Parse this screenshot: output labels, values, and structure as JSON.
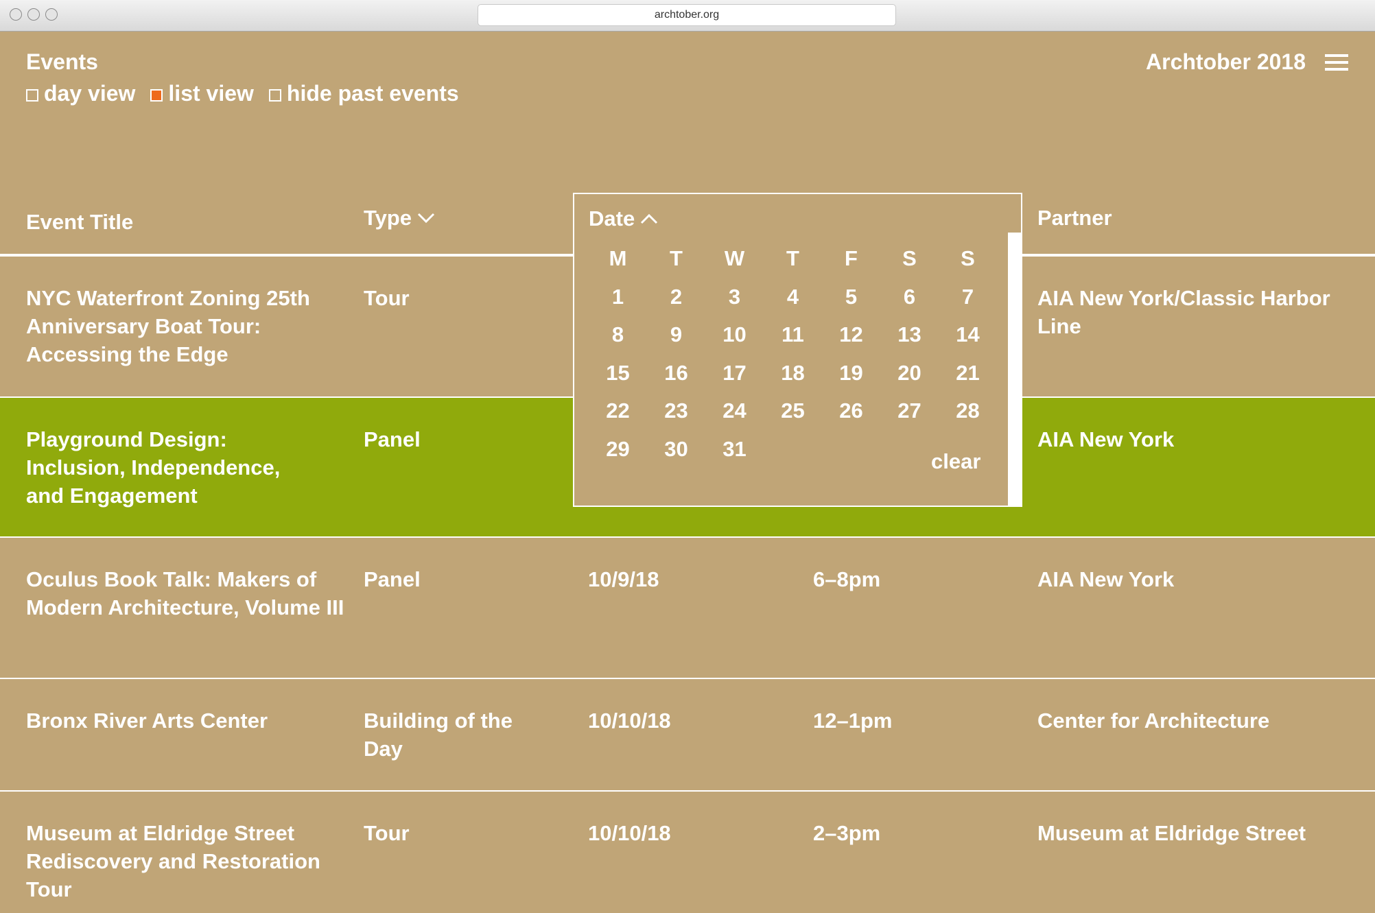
{
  "browser": {
    "url": "archtober.org"
  },
  "header": {
    "title": "Events",
    "brand": "Archtober 2018",
    "views": [
      {
        "label": "day view",
        "checked": false
      },
      {
        "label": "list view",
        "checked": true
      },
      {
        "label": "hide past events",
        "checked": false
      }
    ]
  },
  "table": {
    "columns": {
      "title": "Event Title",
      "type": "Type",
      "date": "Date",
      "partner": "Partner"
    },
    "rows": [
      {
        "title": "NYC Waterfront Zoning 25th Anniversary Boat Tour: Accessing the Edge",
        "type": "Tour",
        "date": "",
        "time": "",
        "partner": "AIA New York/Classic Harbor Line"
      },
      {
        "title": "Playground Design: Inclusion, Independence, and Engagement",
        "type": "Panel",
        "date": "",
        "time": "",
        "partner": "AIA New York",
        "highlighted": true
      },
      {
        "title": "Oculus Book Talk: Makers of Modern Architecture, Volume III",
        "type": "Panel",
        "date": "10/9/18",
        "time": "6–8pm",
        "partner": "AIA New York"
      },
      {
        "title": "Bronx River Arts Center",
        "type": "Building of the Day",
        "date": "10/10/18",
        "time": "12–1pm",
        "partner": "Center for Architecture"
      },
      {
        "title": "Museum at Eldridge Street Rediscovery and Restoration Tour",
        "type": "Tour",
        "date": "10/10/18",
        "time": "2–3pm",
        "partner": "Museum at Eldridge Street"
      }
    ]
  },
  "datepicker": {
    "label": "Date",
    "weekdays": [
      "M",
      "T",
      "W",
      "T",
      "F",
      "S",
      "S"
    ],
    "weeks": [
      [
        "1",
        "2",
        "3",
        "4",
        "5",
        "6",
        "7"
      ],
      [
        "8",
        "9",
        "10",
        "11",
        "12",
        "13",
        "14"
      ],
      [
        "15",
        "16",
        "17",
        "18",
        "19",
        "20",
        "21"
      ],
      [
        "22",
        "23",
        "24",
        "25",
        "26",
        "27",
        "28"
      ],
      [
        "29",
        "30",
        "31",
        "",
        "",
        "",
        ""
      ]
    ],
    "clear_label": "clear"
  },
  "colors": {
    "background": "#c0a577",
    "highlight": "#90aa0c",
    "checked": "#ee6a1c",
    "text": "#ffffff"
  }
}
